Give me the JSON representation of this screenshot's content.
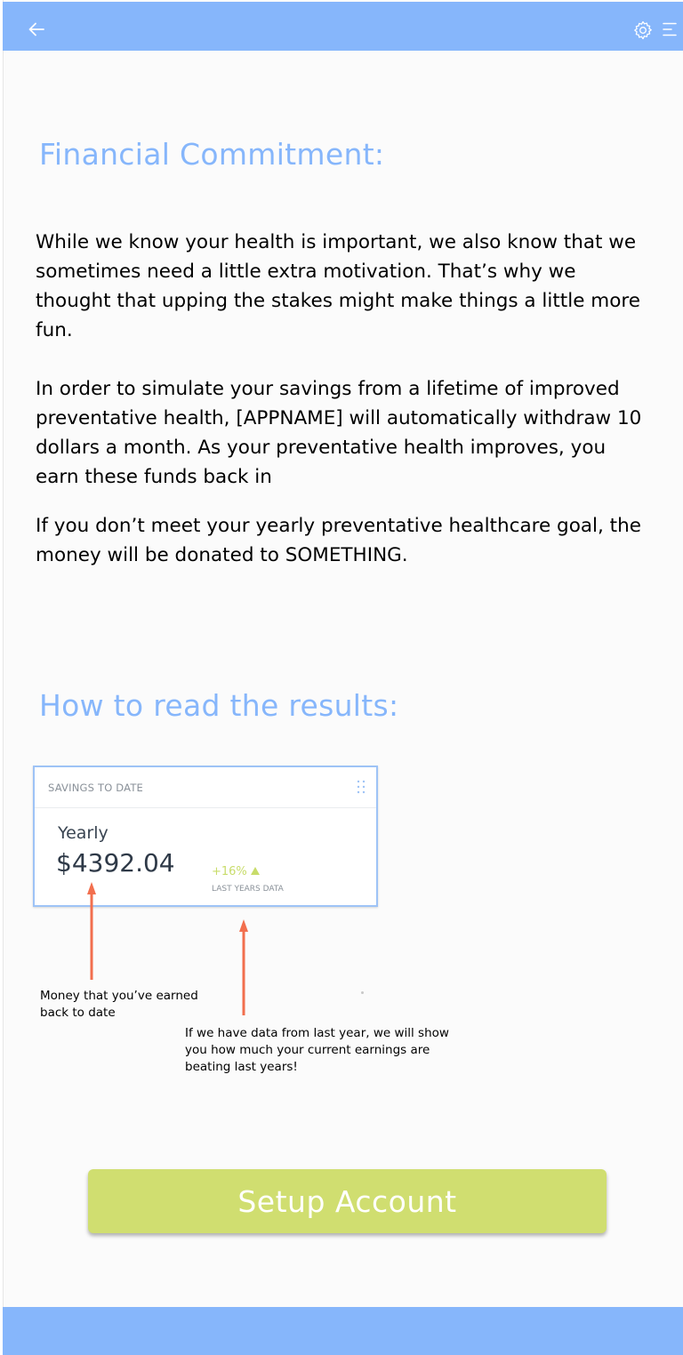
{
  "header": {
    "back_icon": "arrow-left-icon",
    "settings_icon": "gear-icon",
    "menu_icon": "menu-icon"
  },
  "financial": {
    "heading": "Financial Commitment:",
    "paragraph1": "While we know your health is important, we also know that we sometimes need a little extra motivation.  That’s why we thought that upping the stakes might make things a little more fun.",
    "paragraph2": "In order to simulate your savings from a lifetime of improved preventative health, [APPNAME] will automatically withdraw 10 dollars a month. As your preventative health improves, you earn these funds back in",
    "paragraph3": "If you don’t meet your yearly preventative healthcare goal, the money will be donated to SOMETHING."
  },
  "results": {
    "heading": "How to read the results:",
    "card": {
      "title": "SAVINGS TO DATE",
      "period": "Yearly",
      "amount": "$4392.04",
      "change": "+16%",
      "change_label": "LAST YEARS DATA"
    },
    "note_earned": "Money that you’ve earned back to date",
    "note_last_year": "If we have data from last year, we will show you how much your current earnings are beating last years!"
  },
  "actions": {
    "setup_label": "Setup Account"
  },
  "colors": {
    "accent_blue": "#86b6fb",
    "button_green": "#d0de70",
    "arrow_red": "#f26f4e"
  }
}
